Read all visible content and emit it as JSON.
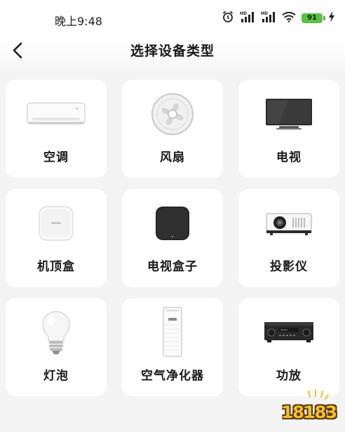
{
  "status_bar": {
    "time": "晚上9:48",
    "battery": "91",
    "icons": [
      "alarm-icon",
      "hd-signal-icon",
      "hd-signal-icon",
      "wifi-icon",
      "battery-icon",
      "charging-icon"
    ]
  },
  "header": {
    "title": "选择设备类型",
    "back_icon": "back-arrow-icon"
  },
  "devices": [
    {
      "label": "空调",
      "icon": "air-conditioner-icon"
    },
    {
      "label": "风扇",
      "icon": "fan-icon"
    },
    {
      "label": "电视",
      "icon": "tv-icon"
    },
    {
      "label": "机顶盒",
      "icon": "set-top-box-icon"
    },
    {
      "label": "电视盒子",
      "icon": "tv-box-icon"
    },
    {
      "label": "投影仪",
      "icon": "projector-icon"
    },
    {
      "label": "灯泡",
      "icon": "light-bulb-icon"
    },
    {
      "label": "空气净化器",
      "icon": "air-purifier-icon"
    },
    {
      "label": "功放",
      "icon": "amplifier-icon"
    }
  ],
  "watermark": {
    "text": "18183"
  }
}
